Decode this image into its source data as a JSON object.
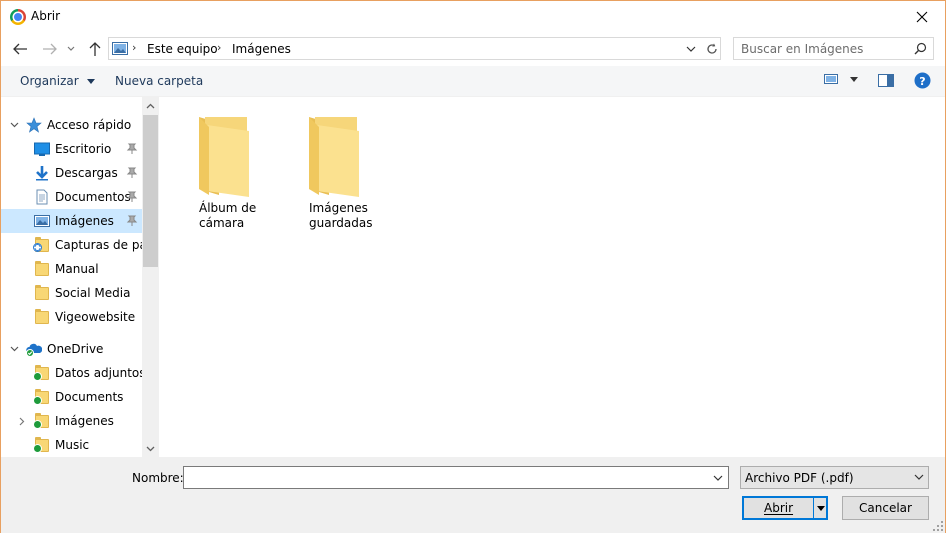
{
  "window": {
    "title": "Abrir"
  },
  "address": {
    "crumbs": [
      "Este equipo",
      "Imágenes"
    ]
  },
  "search": {
    "placeholder": "Buscar en Imágenes"
  },
  "toolbar": {
    "organize_label": "Organizar",
    "new_folder_label": "Nueva carpeta"
  },
  "sidebar": {
    "quick_access": "Acceso rápido",
    "quick_items": [
      {
        "label": "Escritorio",
        "icon": "desktop-icon",
        "pinned": true
      },
      {
        "label": "Descargas",
        "icon": "download-icon",
        "pinned": true
      },
      {
        "label": "Documentos",
        "icon": "documents-icon",
        "pinned": true
      },
      {
        "label": "Imágenes",
        "icon": "pictures-icon",
        "pinned": true,
        "selected": true
      },
      {
        "label": "Capturas de pantalla",
        "icon": "screenshots-folder-icon",
        "pinned": false
      },
      {
        "label": "Manual",
        "icon": "folder-icon",
        "pinned": false
      },
      {
        "label": "Social Media",
        "icon": "folder-icon",
        "pinned": false
      },
      {
        "label": "Vigeowebsite",
        "icon": "folder-icon",
        "pinned": false
      }
    ],
    "onedrive": "OneDrive",
    "onedrive_items": [
      {
        "label": "Datos adjuntos de correo electrónico",
        "icon": "synced-folder-icon"
      },
      {
        "label": "Documents",
        "icon": "synced-folder-icon"
      },
      {
        "label": "Imágenes",
        "icon": "synced-folder-icon",
        "expandable": true
      },
      {
        "label": "Music",
        "icon": "synced-folder-icon"
      }
    ]
  },
  "main": {
    "items": [
      {
        "label_line1": "Álbum de",
        "label_line2": "cámara"
      },
      {
        "label_line1": "Imágenes",
        "label_line2": "guardadas"
      }
    ]
  },
  "bottom": {
    "name_label": "Nombre:",
    "name_value": "",
    "file_type": "Archivo PDF (.pdf)",
    "open_label": "Abrir",
    "cancel_label": "Cancelar"
  },
  "colors": {
    "accent": "#0078d7",
    "selected_bg": "#cce8ff",
    "folder_yellow": "#f8d775",
    "toolbar_text": "#1e395b"
  }
}
